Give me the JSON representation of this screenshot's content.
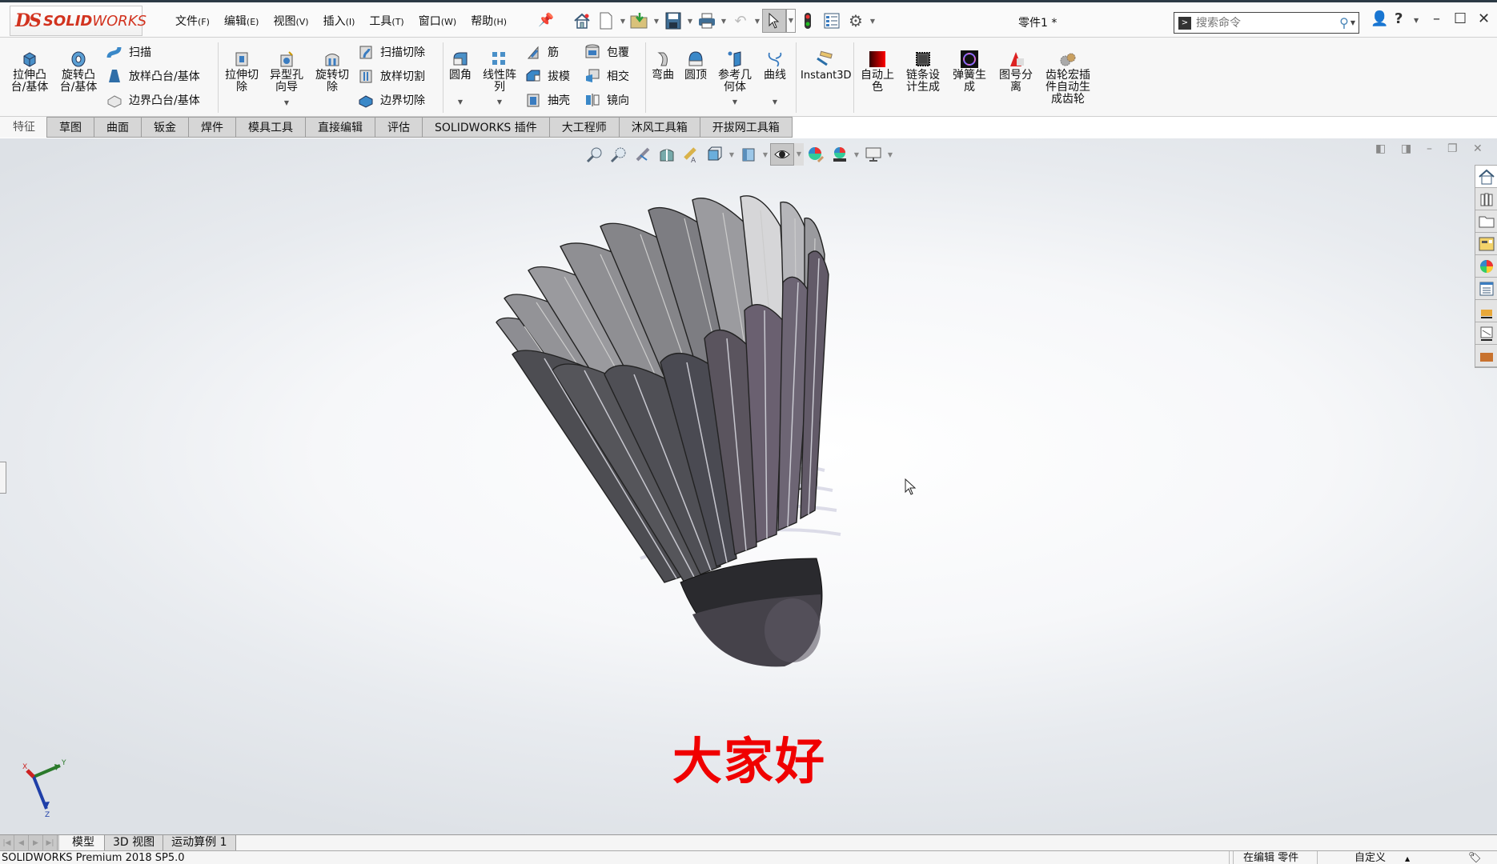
{
  "app": {
    "logo_mark": "DS",
    "logo_solid": "SOLID",
    "logo_works": "WORKS",
    "document_title": "零件1 *"
  },
  "menu": [
    {
      "label": "文件",
      "key": "(F)"
    },
    {
      "label": "编辑",
      "key": "(E)"
    },
    {
      "label": "视图",
      "key": "(V)"
    },
    {
      "label": "插入",
      "key": "(I)"
    },
    {
      "label": "工具",
      "key": "(T)"
    },
    {
      "label": "窗口",
      "key": "(W)"
    },
    {
      "label": "帮助",
      "key": "(H)"
    }
  ],
  "quick_access": [
    "home-icon",
    "new-document-icon",
    "open-icon",
    "save-icon",
    "print-icon",
    "undo-icon",
    "select-icon",
    "rebuild-icon",
    "file-properties-icon",
    "options-icon"
  ],
  "search": {
    "placeholder": "搜索命令"
  },
  "command_manager": {
    "features": {
      "extrude_boss": "拉伸凸\n台/基体",
      "revolve_boss": "旋转凸\n台/基体",
      "sweep": "扫描",
      "loft_boss": "放样凸台/基体",
      "boundary_boss": "边界凸台/基体",
      "extrude_cut": "拉伸切\n除",
      "hole_wizard": "异型孔\n向导",
      "revolve_cut": "旋转切\n除",
      "swept_cut": "扫描切除",
      "lofted_cut": "放样切割",
      "boundary_cut": "边界切除",
      "fillet": "圆角",
      "linear_pattern": "线性阵\n列",
      "rib": "筋",
      "draft": "拔模",
      "shell": "抽壳",
      "wrap": "包覆",
      "intersect": "相交",
      "mirror": "镜向",
      "flex": "弯曲",
      "dome": "圆顶",
      "reference_geometry": "参考几\n何体",
      "curves": "曲线",
      "instant3d": "Instant3D"
    },
    "addins": [
      {
        "label": "自动上\n色",
        "icon": "auto-color-icon"
      },
      {
        "label": "链条设\n计生成",
        "icon": "chain-design-icon"
      },
      {
        "label": "弹簧生\n成",
        "icon": "spring-icon"
      },
      {
        "label": "图号分\n离",
        "icon": "drawing-number-icon"
      },
      {
        "label": "齿轮宏插\n件自动生\n成齿轮",
        "icon": "gear-macro-icon"
      }
    ]
  },
  "tabs": [
    {
      "label": "特征",
      "active": true
    },
    {
      "label": "草图"
    },
    {
      "label": "曲面"
    },
    {
      "label": "钣金"
    },
    {
      "label": "焊件"
    },
    {
      "label": "模具工具"
    },
    {
      "label": "直接编辑"
    },
    {
      "label": "评估"
    },
    {
      "label": "SOLIDWORKS 插件"
    },
    {
      "label": "大工程师"
    },
    {
      "label": "沐风工具箱"
    },
    {
      "label": "开拔网工具箱"
    }
  ],
  "viewport": {
    "overlay_text": "大家好",
    "overlay_color": "#f00000",
    "triad": {
      "x": "X",
      "y": "Y",
      "z": "Z"
    }
  },
  "bottom_tabs": [
    {
      "label": "模型",
      "active": true
    },
    {
      "label": "3D 视图"
    },
    {
      "label": "运动算例 1"
    }
  ],
  "status": {
    "product": "SOLIDWORKS Premium 2018 SP5.0",
    "editing": "在编辑 零件",
    "units": "自定义"
  }
}
